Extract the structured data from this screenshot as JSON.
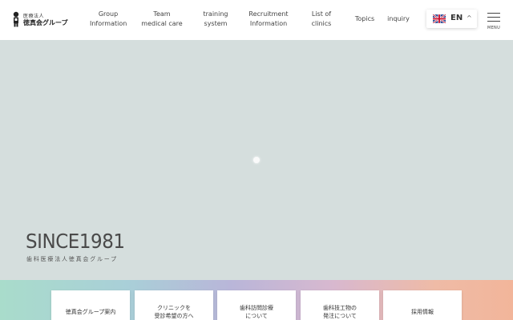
{
  "header": {
    "logo": {
      "sub": "医療法人",
      "main": "徳真会グループ"
    },
    "nav": [
      {
        "line1": "Group",
        "line2": "Information"
      },
      {
        "line1": "Team",
        "line2": "medical care"
      },
      {
        "line1": "training",
        "line2": "system"
      },
      {
        "line1": "Recruitment",
        "line2": "Information"
      },
      {
        "line1": "List of",
        "line2": "clinics"
      },
      {
        "line1": "Topics",
        "line2": ""
      },
      {
        "line1": "inquiry",
        "line2": ""
      }
    ],
    "language": {
      "code": "EN",
      "caret": "^"
    },
    "menu_label": "MENU"
  },
  "hero": {
    "title": "SINCE1981",
    "subtitle": "歯科医療法人徳真会グループ"
  },
  "cards": [
    {
      "line1": "徳真会グループ案内",
      "line2": ""
    },
    {
      "line1": "クリニックを",
      "line2": "受診希望の方へ"
    },
    {
      "line1": "歯科訪問診療",
      "line2": "について"
    },
    {
      "line1": "歯科技工物の",
      "line2": "発注について"
    },
    {
      "line1": "採用情報",
      "line2": ""
    }
  ],
  "colors": {
    "hero_bg": "#d5dedd",
    "band_start": "#a9dccb",
    "band_end": "#f2b59a"
  },
  "icons": {
    "logo": "doctor-figure-logo",
    "flag": "uk-flag-icon",
    "menu": "hamburger-icon",
    "loader": "loading-dot"
  }
}
